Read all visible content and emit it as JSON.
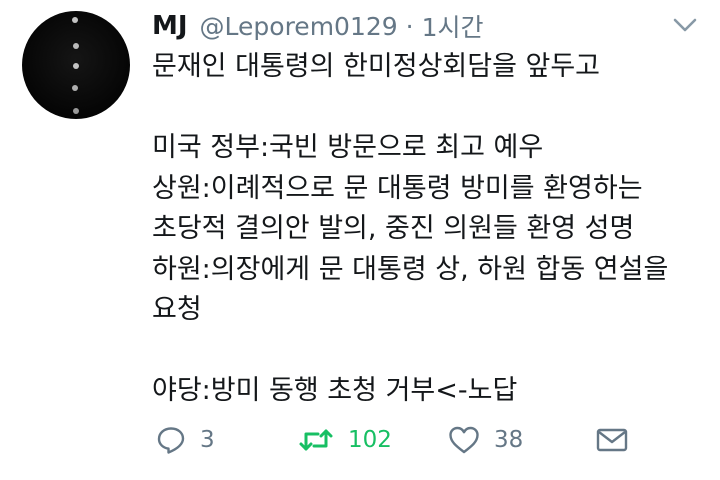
{
  "tweet": {
    "display_name": "MJ",
    "handle": "@Leporem0129",
    "separator": "·",
    "time": "1시간",
    "lines": [
      "문재인 대통령의 한미정상회담을 앞두고",
      "",
      "미국 정부:국빈 방문으로 최고 예우",
      "상원:이례적으로 문 대통령 방미를 환영하는",
      "초당적 결의안 발의, 중진 의원들 환영 성명",
      "하원:의장에게 문 대통령 상, 하원 합동 연설을",
      "요청",
      "",
      "야당:방미 동행 초청 거부<-노답"
    ]
  },
  "actions": {
    "reply_count": "3",
    "retweet_count": "102",
    "like_count": "38"
  },
  "icons": {
    "reply": "reply-icon",
    "retweet": "retweet-icon",
    "like": "heart-icon",
    "dm": "envelope-icon",
    "more": "chevron-down-icon"
  },
  "colors": {
    "text": "#14171a",
    "secondary": "#657786",
    "retweet_active": "#17bf63"
  }
}
